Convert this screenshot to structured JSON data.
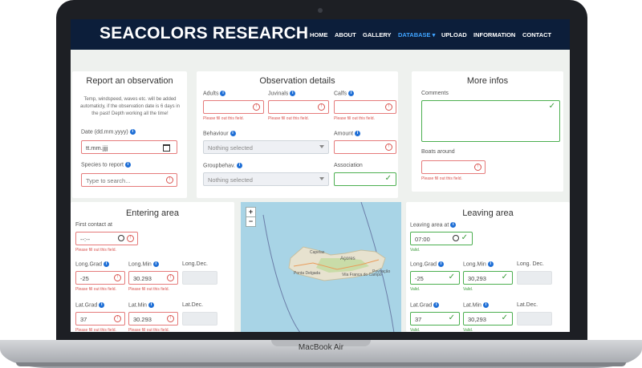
{
  "device": {
    "label": "MacBook Air"
  },
  "nav": {
    "brand": "SEACOLORS RESEARCH",
    "items": [
      "HOME",
      "ABOUT",
      "GALLERY",
      "DATABASE ▾",
      "UPLOAD",
      "INFORMATION",
      "CONTACT"
    ],
    "active_index": 3
  },
  "report": {
    "title": "Report an observation",
    "description": "Temp, windspeed, waves etc. will be added automaticly, if the observation date is 6 days in the past! Depth working all the time!",
    "date_label": "Date (dd.mm.yyyy)",
    "date_value": "tt.mm.jjjj",
    "species_label": "Species to report",
    "species_placeholder": "Type to search..."
  },
  "details": {
    "title": "Observation details",
    "adults_label": "Adults",
    "juvinals_label": "Juvinals",
    "calfs_label": "Calfs",
    "error_text": "Please fill out this field.",
    "behaviour_label": "Behaviour",
    "behaviour_value": "Nothing selected",
    "amount_label": "Amount",
    "groupbehav_label": "Groupbehav.",
    "groupbehav_value": "Nothing selected",
    "association_label": "Association"
  },
  "more": {
    "title": "More infos",
    "comments_label": "Comments",
    "boats_label": "Boats around",
    "error_text": "Please fill out this field."
  },
  "entering": {
    "title": "Entering area",
    "first_contact_label": "First contact at",
    "time_value": "--:--",
    "long_grad_label": "Long.Grad",
    "long_min_label": "Long.Min",
    "long_dec_label": "Long.Dec.",
    "long_grad_value": "-25",
    "long_min_value": "30.293",
    "lat_grad_label": "Lat.Grad",
    "lat_min_label": "Lat.Min",
    "lat_dec_label": "Lat.Dec.",
    "lat_grad_value": "37",
    "lat_min_value": "30.293",
    "error_text": "Please fill out this field."
  },
  "leaving": {
    "title": "Leaving area",
    "leaving_label": "Leaving area at",
    "time_value": "07:00",
    "valid_text": "Valid.",
    "long_grad_label": "Long.Grad",
    "long_min_label": "Long.Min",
    "long_dec_label": "Long. Dec.",
    "long_grad_value": "-25",
    "long_min_value": "30,293",
    "lat_grad_label": "Lat.Grad",
    "lat_min_label": "Lat.Min",
    "lat_dec_label": "Lat.Dec.",
    "lat_grad_value": "37",
    "lat_min_value": "30,293"
  },
  "map": {
    "zoom_in": "+",
    "zoom_out": "−",
    "places": [
      "Capelas",
      "Açores",
      "Ponta Delgada",
      "Vila Franca do Campo",
      "Povoação"
    ]
  },
  "icons": {
    "info": "info-icon",
    "error": "error-icon",
    "valid": "check-icon"
  },
  "colors": {
    "nav_bg": "#0c1e3a",
    "active_nav": "#3fa3ff",
    "error": "#d9534f",
    "valid": "#3a9a3a",
    "info": "#1f6fd6"
  }
}
